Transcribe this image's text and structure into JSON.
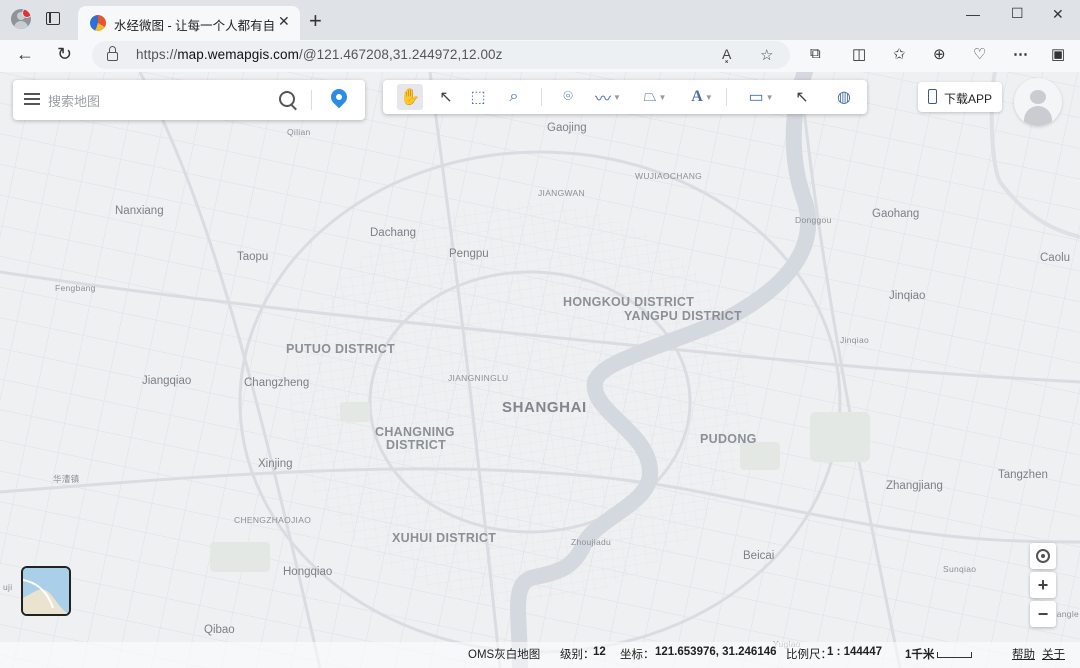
{
  "browser": {
    "tab_title": "水经微图 - 让每一个人都有自己的",
    "tab_close": "✕",
    "new_tab": "+",
    "url_prefix": "https://",
    "url_host": "map.wemapgis.com",
    "url_path": "/@121.467208,31.244972,12.00z",
    "window_controls": [
      "—",
      "☐",
      "✕"
    ],
    "read_aloud": "A͓",
    "icons": [
      "back-icon",
      "refresh-icon",
      "favorites-star-icon",
      "extensions-icon",
      "split-screen-icon",
      "favorites-icon",
      "collections-icon",
      "browser-essentials-icon",
      "more-icon",
      "sidebar-icon"
    ]
  },
  "map": {
    "search": {
      "placeholder": "搜索地图"
    },
    "download_app": "下载APP",
    "toolbar_tools": [
      "pan-hand",
      "select-arrow",
      "box-select",
      "zoom-box",
      "marker",
      "polyline",
      "polygon",
      "text",
      "measure",
      "pick-info",
      "globe"
    ],
    "labels": [
      {
        "text": "Qilian",
        "cls": "sm"
      },
      {
        "text": "Gaojing",
        "cls": "md"
      },
      {
        "text": "WUJIAOCHANG",
        "cls": "sm"
      },
      {
        "text": "JIANGWAN",
        "cls": "sm"
      },
      {
        "text": "Nanxiang",
        "cls": "md"
      },
      {
        "text": "Dachang",
        "cls": "md"
      },
      {
        "text": "Pengpu",
        "cls": "md"
      },
      {
        "text": "Donggou",
        "cls": "sm"
      },
      {
        "text": "Gaohang",
        "cls": "md"
      },
      {
        "text": "Taopu",
        "cls": "md"
      },
      {
        "text": "Caolu",
        "cls": "md"
      },
      {
        "text": "Fengbang",
        "cls": "sm"
      },
      {
        "text": "HONGKOU DISTRICT",
        "cls": "dist"
      },
      {
        "text": "YANGPU DISTRICT",
        "cls": "dist"
      },
      {
        "text": "Jinqiao",
        "cls": "md"
      },
      {
        "text": "Jinqiao",
        "cls": "sm"
      },
      {
        "text": "PUTUO DISTRICT",
        "cls": "dist"
      },
      {
        "text": "JIANGNINGLU",
        "cls": "sm"
      },
      {
        "text": "Jiangqiao",
        "cls": "md"
      },
      {
        "text": "Changzheng",
        "cls": "md"
      },
      {
        "text": "SHANGHAI",
        "cls": "big"
      },
      {
        "text": "CHANGNING",
        "cls": "dist"
      },
      {
        "text": "DISTRICT",
        "cls": "dist"
      },
      {
        "text": "PUDONG",
        "cls": "dist"
      },
      {
        "text": "Xinjing",
        "cls": "md"
      },
      {
        "text": "华漕镇",
        "cls": "sm"
      },
      {
        "text": "Tangzhen",
        "cls": "md"
      },
      {
        "text": "Zhangjiang",
        "cls": "md"
      },
      {
        "text": "CHENGZHAOJIAO",
        "cls": "sm"
      },
      {
        "text": "XUHUI DISTRICT",
        "cls": "dist"
      },
      {
        "text": "Zhoujiadu",
        "cls": "sm"
      },
      {
        "text": "Beicai",
        "cls": "md"
      },
      {
        "text": "Sunqiao",
        "cls": "sm"
      },
      {
        "text": "Hongqiao",
        "cls": "md"
      },
      {
        "text": "Qibao",
        "cls": "md"
      },
      {
        "text": "Yugiao",
        "cls": "sm"
      },
      {
        "text": "uji",
        "cls": "sm"
      },
      {
        "text": "Jiangle",
        "cls": "sm"
      }
    ],
    "zoom_in": "+",
    "zoom_out": "−"
  },
  "status": {
    "basemap_name": "OMS灰白地图",
    "level_label": "级别：",
    "level_value": "12",
    "coord_label": "坐标：",
    "coord_value": "121.653976, 31.246146",
    "scale_label": "比例尺：",
    "scale_value": "1 : 144447",
    "scale_bar_text": "1千米",
    "help": "帮助",
    "about": "关于"
  },
  "colors": {
    "river": "#d3d9df",
    "map_bg": "#eef0f2",
    "accent": "#2b8be6"
  }
}
